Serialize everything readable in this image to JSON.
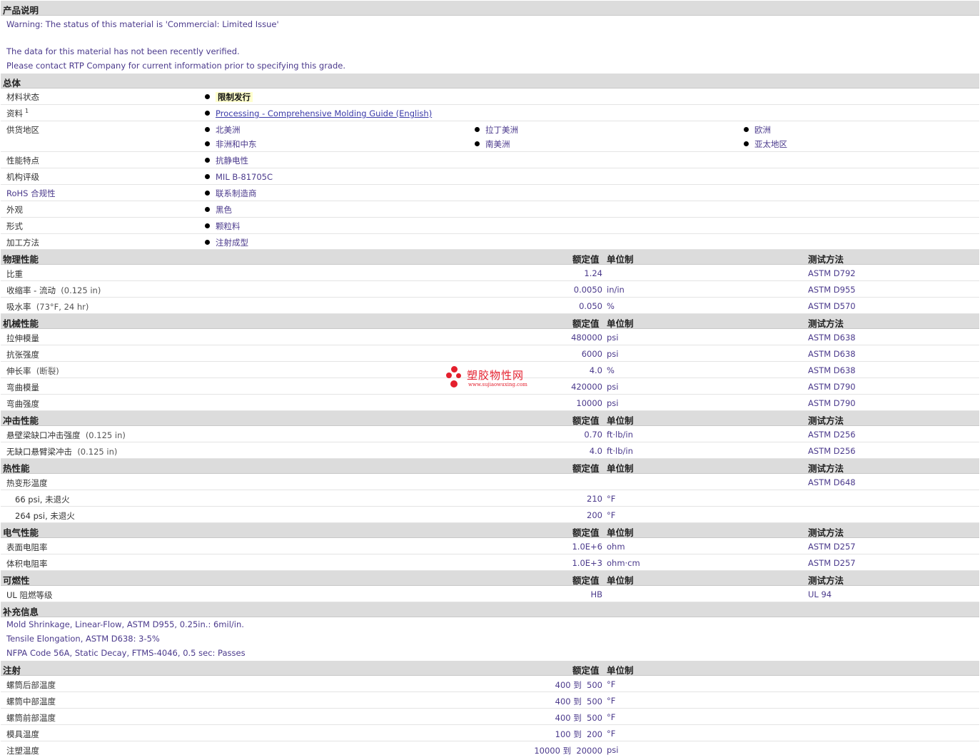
{
  "product": {
    "title": "产品说明",
    "lines": [
      "Warning: The status of this material is 'Commercial: Limited Issue'",
      "The data for this material has not been recently verified.",
      "Please contact RTP Company for current information prior to specifying this grade."
    ]
  },
  "general": {
    "title": "总体",
    "status_label": "材料状态",
    "status_value": "限制发行",
    "docs_label": "资料",
    "docs_sup": "1",
    "docs_link": "Processing - Comprehensive Molding Guide (English)",
    "supply_label": "供货地区",
    "supply": [
      "北美洲",
      "拉丁美洲",
      "欧洲",
      "非洲和中东",
      "南美洲",
      "亚太地区"
    ],
    "features_label": "性能特点",
    "features_value": "抗静电性",
    "agency_label": "机构评级",
    "agency_value": "MIL B-81705C",
    "rohs_label": "RoHS 合规性",
    "rohs_value": "联系制造商",
    "appearance_label": "外观",
    "appearance_value": "黑色",
    "form_label": "形式",
    "form_value": "颗粒料",
    "process_label": "加工方法",
    "process_value": "注射成型"
  },
  "headers": {
    "value": "额定值",
    "unit": "单位制",
    "method": "测试方法"
  },
  "sections": [
    {
      "title": "物理性能",
      "rows": [
        {
          "label": "比重",
          "cond": "",
          "value": "1.24",
          "unit": "",
          "method": "ASTM D792"
        },
        {
          "label": "收缩率  - 流动",
          "cond": "(0.125 in)",
          "value": "0.0050",
          "unit": "in/in",
          "method": "ASTM D955"
        },
        {
          "label": "吸水率",
          "cond": "(73°F, 24 hr)",
          "value": "0.050",
          "unit": "%",
          "method": "ASTM D570"
        }
      ]
    },
    {
      "title": "机械性能",
      "rows": [
        {
          "label": "拉伸模量",
          "cond": "",
          "value": "480000",
          "unit": "psi",
          "method": "ASTM D638"
        },
        {
          "label": "抗张强度",
          "cond": "",
          "value": "6000",
          "unit": "psi",
          "method": "ASTM D638"
        },
        {
          "label": "伸长率",
          "cond": "(断裂)",
          "value": "4.0",
          "unit": "%",
          "method": "ASTM D638"
        },
        {
          "label": "弯曲模量",
          "cond": "",
          "value": "420000",
          "unit": "psi",
          "method": "ASTM D790"
        },
        {
          "label": "弯曲强度",
          "cond": "",
          "value": "10000",
          "unit": "psi",
          "method": "ASTM D790"
        }
      ]
    },
    {
      "title": "冲击性能",
      "rows": [
        {
          "label": "悬壁梁缺口冲击强度",
          "cond": "(0.125 in)",
          "value": "0.70",
          "unit": "ft·lb/in",
          "method": "ASTM D256"
        },
        {
          "label": "无缺口悬臂梁冲击",
          "cond": "(0.125 in)",
          "value": "4.0",
          "unit": "ft·lb/in",
          "method": "ASTM D256"
        }
      ]
    },
    {
      "title": "热性能",
      "rows": [
        {
          "label": "热变形温度",
          "cond": "",
          "value": "",
          "unit": "",
          "method": "ASTM D648"
        },
        {
          "label": "66 psi, 未退火",
          "cond": "",
          "value": "210",
          "unit": "°F",
          "method": "",
          "indent": true
        },
        {
          "label": "264 psi, 未退火",
          "cond": "",
          "value": "200",
          "unit": "°F",
          "method": "",
          "indent": true
        }
      ]
    },
    {
      "title": "电气性能",
      "rows": [
        {
          "label": "表面电阻率",
          "cond": "",
          "value": "1.0E+6",
          "unit": "ohm",
          "method": "ASTM D257"
        },
        {
          "label": "体积电阻率",
          "cond": "",
          "value": "1.0E+3",
          "unit": "ohm·cm",
          "method": "ASTM D257"
        }
      ]
    },
    {
      "title": "可燃性",
      "rows": [
        {
          "label": "UL 阻燃等级",
          "cond": "",
          "value": "HB",
          "unit": "",
          "method": "UL 94"
        }
      ]
    }
  ],
  "supplemental": {
    "title": "补充信息",
    "lines": [
      "Mold Shrinkage, Linear-Flow, ASTM D955, 0.25in.: 6mil/in.",
      "Tensile Elongation, ASTM D638: 3-5%",
      "NFPA Code 56A, Static Decay, FTMS-4046, 0.5 sec: Passes"
    ]
  },
  "injection": {
    "title": "注射",
    "rows": [
      {
        "label": "螺筒后部温度",
        "value": "400 到  500",
        "unit": "°F"
      },
      {
        "label": "螺筒中部温度",
        "value": "400 到  500",
        "unit": "°F"
      },
      {
        "label": "螺筒前部温度",
        "value": "400 到  500",
        "unit": "°F"
      },
      {
        "label": "模具温度",
        "value": "100 到  200",
        "unit": "°F"
      },
      {
        "label": "注塑温度",
        "value": "10000 到  20000",
        "unit": "psi"
      }
    ]
  },
  "watermark": {
    "cn": "塑胶物性网",
    "en": "www.sujiaowuxing.com",
    "color": "#e41f2d"
  },
  "colors": {
    "section_bg": "#dcdcdc",
    "value_text": "#4b3a8c",
    "highlight": "#ffffcc"
  }
}
